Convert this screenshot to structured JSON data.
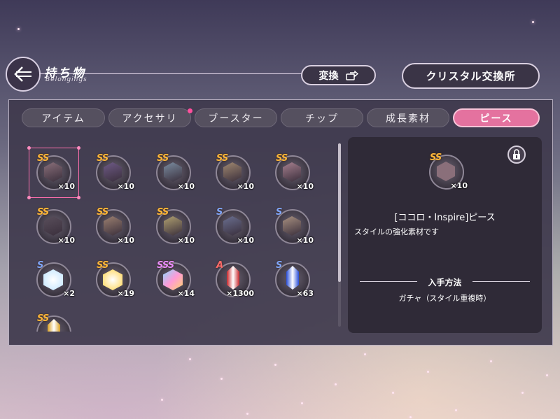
{
  "header": {
    "title": "持ち物",
    "subtitle": "Belongings",
    "exchange_label": "変換",
    "crystal_exchange_label": "クリスタル交換所"
  },
  "tabs": [
    {
      "label": "アイテム",
      "active": false
    },
    {
      "label": "アクセサリ",
      "active": false,
      "badge": true
    },
    {
      "label": "ブースター",
      "active": false
    },
    {
      "label": "チップ",
      "active": false
    },
    {
      "label": "成長素材",
      "active": false
    },
    {
      "label": "ピース",
      "active": true
    }
  ],
  "items": [
    {
      "rank": "SS",
      "count": "×10",
      "kind": "portrait",
      "selected": true,
      "color": "#8a6f7a"
    },
    {
      "rank": "SS",
      "count": "×10",
      "kind": "portrait",
      "color": "#6e5a86"
    },
    {
      "rank": "SS",
      "count": "×10",
      "kind": "portrait",
      "color": "#7a8ca0"
    },
    {
      "rank": "SS",
      "count": "×10",
      "kind": "portrait",
      "color": "#a08870"
    },
    {
      "rank": "SS",
      "count": "×10",
      "kind": "portrait",
      "color": "#a67f8e"
    },
    {
      "rank": "SS",
      "count": "×10",
      "kind": "portrait",
      "color": "#5a4f5c"
    },
    {
      "rank": "SS",
      "count": "×10",
      "kind": "portrait",
      "color": "#9c8070"
    },
    {
      "rank": "SS",
      "count": "×10",
      "kind": "portrait",
      "color": "#b0a070"
    },
    {
      "rank": "S",
      "count": "×10",
      "kind": "portrait",
      "color": "#6a6f90"
    },
    {
      "rank": "S",
      "count": "×10",
      "kind": "portrait",
      "color": "#a89080"
    },
    {
      "rank": "S",
      "count": "×2",
      "kind": "crystal-blue",
      "color": "#bfe4ff"
    },
    {
      "rank": "SS",
      "count": "×19",
      "kind": "crystal-gold",
      "color": "#ffd24a"
    },
    {
      "rank": "SSS",
      "count": "×14",
      "kind": "crystal-rainbow",
      "color": "#ff9ad6"
    },
    {
      "rank": "A",
      "count": "×1300",
      "kind": "gem-red",
      "color": "#c8262a"
    },
    {
      "rank": "S",
      "count": "×63",
      "kind": "gem-blue",
      "color": "#2a4fd8"
    },
    {
      "rank": "SS",
      "count": "",
      "kind": "gem-gold-partial",
      "color": "#d9a021"
    }
  ],
  "detail": {
    "rank": "SS",
    "count": "×10",
    "name": "[ココロ・Inspire]ピース",
    "description": "スタイルの強化素材です",
    "how_to_obtain_title": "入手方法",
    "how_to_obtain_value": "ガチャ（スタイル重複時）",
    "locked": true
  },
  "scroll": {
    "visible_fraction": 0.75
  }
}
